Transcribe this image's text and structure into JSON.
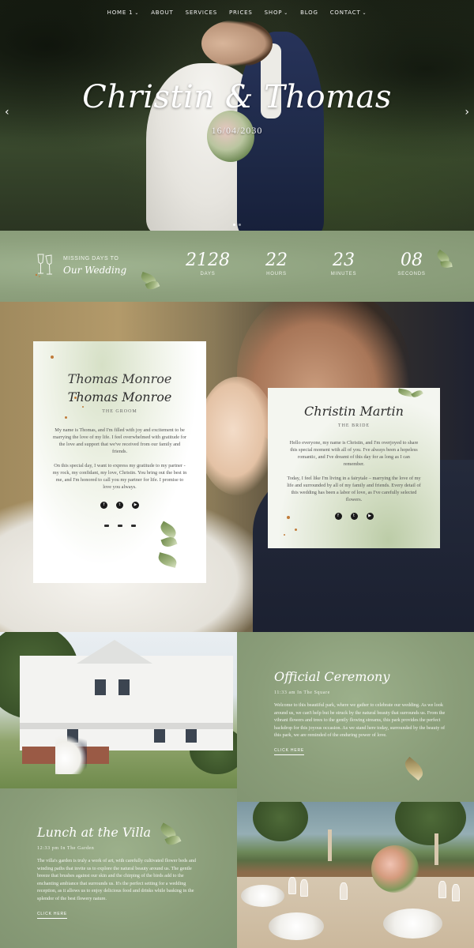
{
  "nav": {
    "items": [
      {
        "label": "HOME 1",
        "has_dropdown": true
      },
      {
        "label": "ABOUT",
        "has_dropdown": false
      },
      {
        "label": "SERVICES",
        "has_dropdown": false
      },
      {
        "label": "PRICES",
        "has_dropdown": false
      },
      {
        "label": "SHOP",
        "has_dropdown": true
      },
      {
        "label": "BLOG",
        "has_dropdown": false
      },
      {
        "label": "CONTACT",
        "has_dropdown": true
      }
    ],
    "dropdown_glyph": "⌄"
  },
  "hero": {
    "title": "Christin & Thomas",
    "date": "16/04/2030",
    "prev_glyph": "‹",
    "next_glyph": "›",
    "slides": 2,
    "active_slide": 1
  },
  "countdown": {
    "label": "MISSING DAYS TO",
    "script": "Our Wedding",
    "units": [
      {
        "value": "2128",
        "caption": "DAYS"
      },
      {
        "value": "22",
        "caption": "HOURS"
      },
      {
        "value": "23",
        "caption": "MINUTES"
      },
      {
        "value": "08",
        "caption": "SECONDS"
      }
    ]
  },
  "groom": {
    "name": "Thomas Monroe",
    "role": "THE GROOM",
    "paragraph1": "My name is Thomas, and I'm filled with joy and excitement to be marrying the love of my life. I feel overwhelmed with gratitude for the love and support that we've received from our family and friends.",
    "paragraph2": "On this special day, I want to express my gratitude to my partner - my rock, my confidant, my love, Christin. You bring out the best in me, and I'm honored to call you my partner for life. I promise to love you always."
  },
  "bride": {
    "name": "Christin Martin",
    "role": "THE BRIDE",
    "paragraph1": "Hello everyone, my name is Christin, and I'm overjoyed to share this special moment with all of you. I've always been a hopeless romantic, and I've dreamt of this day for as long as I can remember.",
    "paragraph2": "Today, I feel like I'm living in a fairytale – marrying the love of my life and surrounded by all of my family and friends. Every detail of this wedding has been a labor of love, as I've carefully selected flowers."
  },
  "social": {
    "icons": [
      "facebook-icon",
      "twitter-icon",
      "youtube-icon"
    ],
    "glyphs": [
      "f",
      "t",
      "▶"
    ]
  },
  "ceremony": {
    "title": "Official Ceremony",
    "meta": "11:33 am In The Square",
    "body": "Welcome to this beautiful park, where we gather to celebrate our wedding. As we look around us, we can't help but be struck by the natural beauty that surrounds us. From the vibrant flowers and trees to the gently flowing streams, this park provides the perfect backdrop for this joyous occasion. As we stand here today, surrounded by the beauty of this park, we are reminded of the enduring power of love.",
    "link": "CLICK HERE"
  },
  "lunch": {
    "title": "Lunch at the Villa",
    "meta": "12:33 pm In The Garden",
    "body": "The villa's garden is truly a work of art, with carefully cultivated flower beds and winding paths that invite us to explore the natural beauty around us. The gentle breeze that brushes against our skin and the chirping of the birds add to the enchanting ambiance that surrounds us. It's the perfect setting for a wedding reception, as it allows us to enjoy delicious food and drinks while basking in the splendor of the best flowery nature.",
    "link": "CLICK HERE"
  }
}
